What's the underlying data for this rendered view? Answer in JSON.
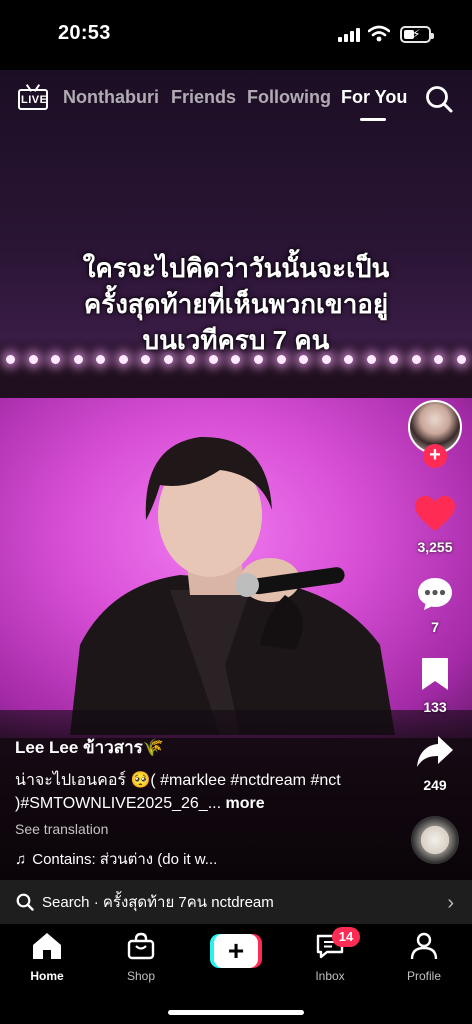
{
  "status_bar": {
    "time": "20:53"
  },
  "top_nav": {
    "live_label": "LIVE",
    "tabs": [
      {
        "label": "Nonthaburi"
      },
      {
        "label": "Friends"
      },
      {
        "label": "Following"
      },
      {
        "label": "For You"
      }
    ],
    "active_tab": "For You"
  },
  "video": {
    "caption_lines": [
      "ใครจะไปคิดว่าวันนั้นจะเป็น",
      "ครั้งสุดท้ายที่เห็นพวกเขาอยู่",
      "บนเวทีครบ 7 คน"
    ]
  },
  "rail": {
    "likes": "3,255",
    "comments": "7",
    "saves": "133",
    "shares": "249",
    "like_color": "#fe2c55"
  },
  "post": {
    "username": "Lee Lee ข้าวสาร🌾",
    "description": "น่าจะไปเอนคอร์ 🥺( #marklee #nctdream #nct )#SMTOWNLIVE2025_26_...",
    "more_label": "more",
    "see_translation": "See translation",
    "sound": "Contains: ส่วนต่าง (do it w..."
  },
  "search_bar": {
    "text": "Search · ครั้งสุดท้าย 7คน nctdream"
  },
  "tab_bar": {
    "tabs": [
      {
        "label": "Home"
      },
      {
        "label": "Shop"
      },
      {
        "label": "Inbox"
      },
      {
        "label": "Profile"
      }
    ],
    "inbox_badge": "14"
  },
  "colors": {
    "accent": "#fe2c55",
    "accent2": "#25f4ee",
    "stage_pink": "#d84fd6"
  }
}
